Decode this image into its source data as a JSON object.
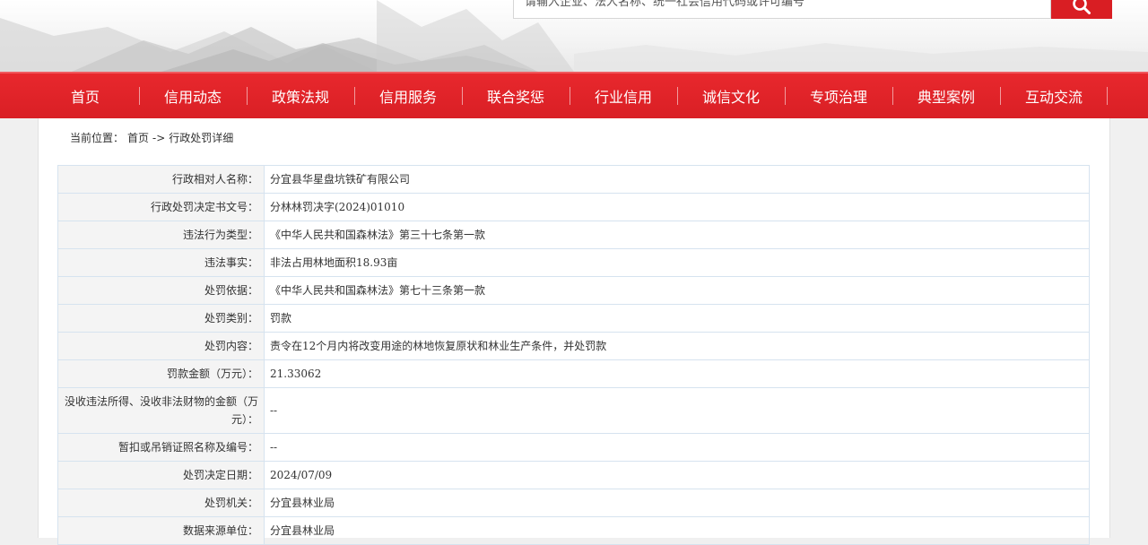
{
  "header": {
    "search_text": "请输入企业、法人名称、统一社会信用代码或许可编号"
  },
  "nav": {
    "items": [
      "首页",
      "信用动态",
      "政策法规",
      "信用服务",
      "联合奖惩",
      "行业信用",
      "诚信文化",
      "专项治理",
      "典型案例",
      "互动交流"
    ]
  },
  "breadcrumb": {
    "prefix": "当前位置：",
    "home": "首页",
    "arrow": "->",
    "current": "行政处罚详细"
  },
  "detail": {
    "rows": [
      {
        "label": "行政相对人名称：",
        "value": "分宜县华星盘坑铁矿有限公司"
      },
      {
        "label": "行政处罚决定书文号：",
        "value": "分林林罚决字(2024)01010"
      },
      {
        "label": "违法行为类型：",
        "value": "《中华人民共和国森林法》第三十七条第一款"
      },
      {
        "label": "违法事实：",
        "value": "非法占用林地面积18.93亩"
      },
      {
        "label": "处罚依据：",
        "value": "《中华人民共和国森林法》第七十三条第一款"
      },
      {
        "label": "处罚类别：",
        "value": "罚款"
      },
      {
        "label": "处罚内容：",
        "value": "责令在12个月内将改变用途的林地恢复原状和林业生产条件，并处罚款"
      },
      {
        "label": "罚款金额（万元）：",
        "value": "21.33062"
      },
      {
        "label": "没收违法所得、没收非法财物的金额（万元）：",
        "value": "--"
      },
      {
        "label": "暂扣或吊销证照名称及编号：",
        "value": "--"
      },
      {
        "label": "处罚决定日期：",
        "value": "2024/07/09"
      },
      {
        "label": "处罚机关：",
        "value": "分宜县林业局"
      },
      {
        "label": "数据来源单位：",
        "value": "分宜县林业局"
      }
    ]
  },
  "colors": {
    "nav_red": "#d91f25",
    "table_border": "#d6e3ef",
    "label_bg": "#f4f4f4"
  }
}
